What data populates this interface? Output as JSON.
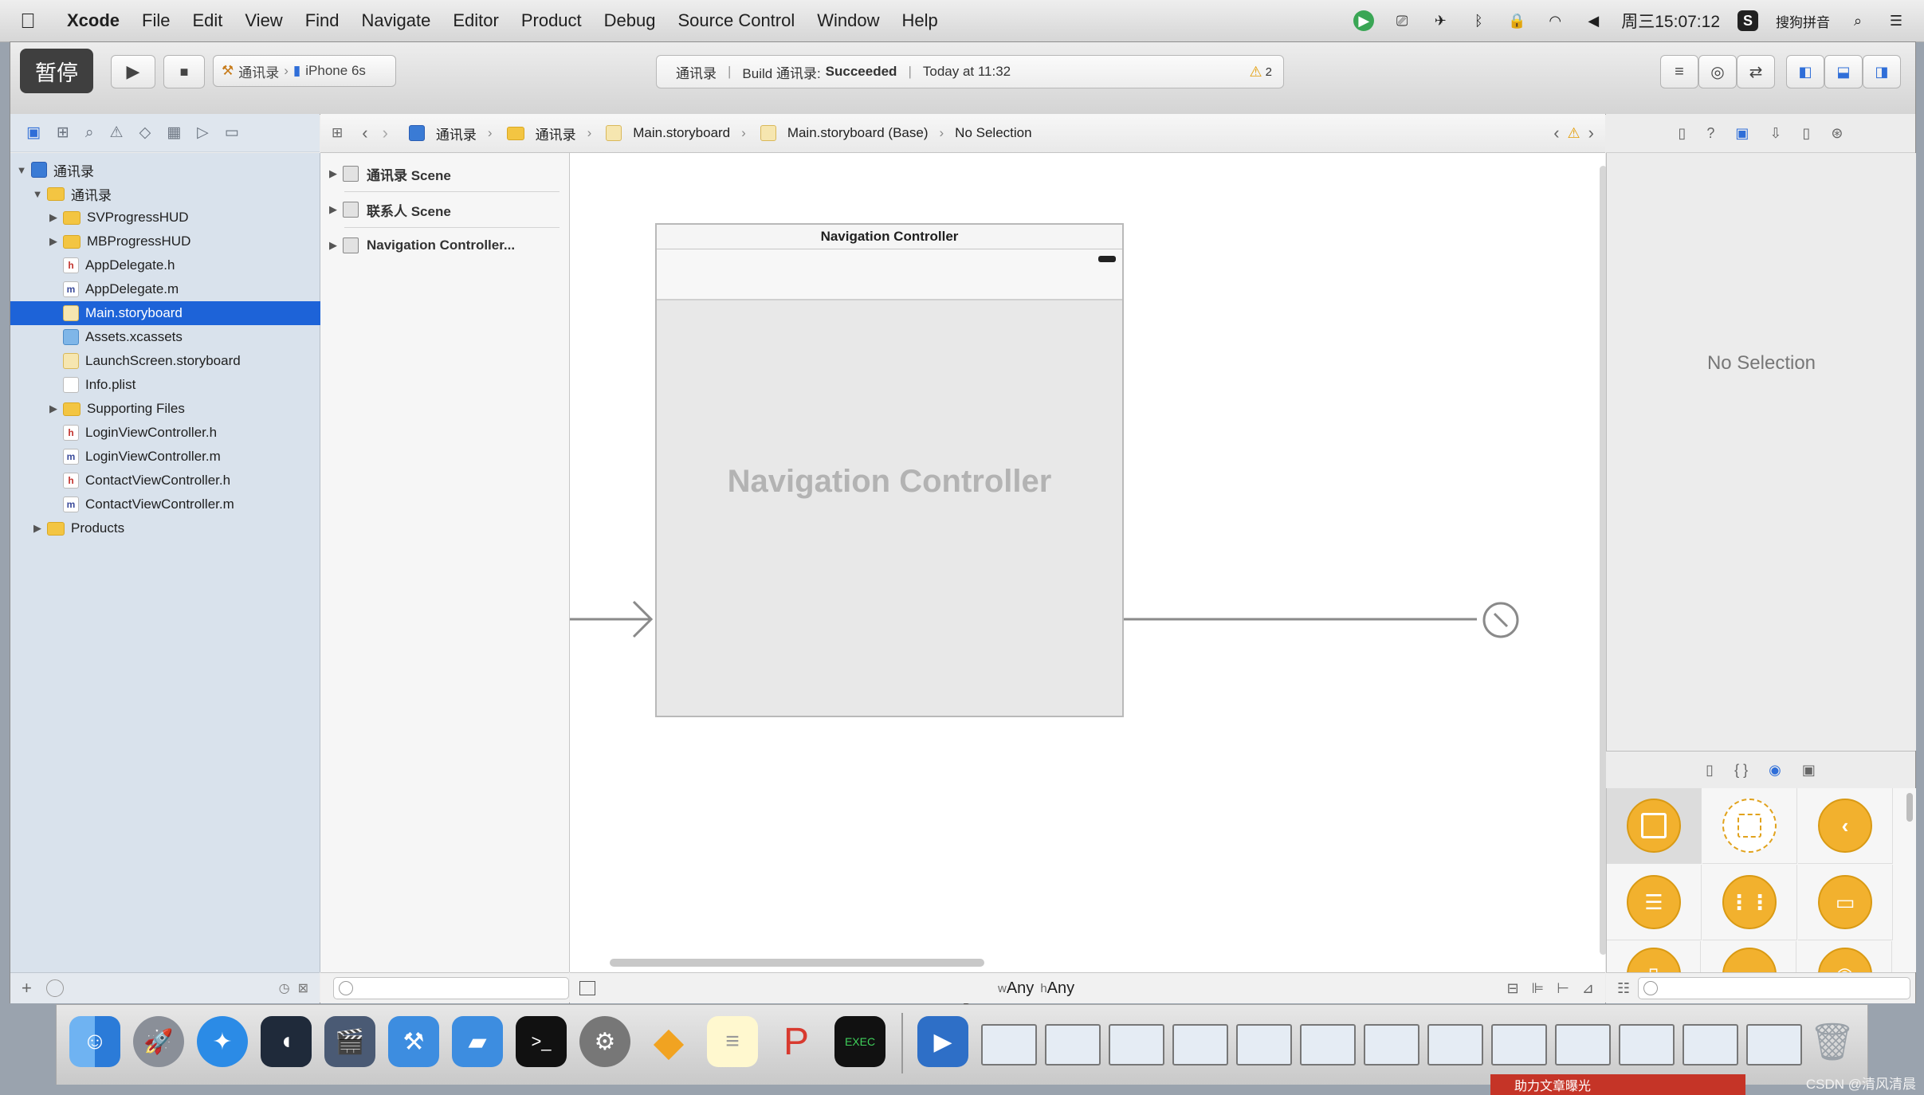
{
  "menubar": {
    "app": "Xcode",
    "items": [
      "File",
      "Edit",
      "View",
      "Find",
      "Navigate",
      "Editor",
      "Product",
      "Debug",
      "Source Control",
      "Window",
      "Help"
    ],
    "clock": "周三15:07:12",
    "input_method": "搜狗拼音"
  },
  "toolbar": {
    "pause_badge": "暂停",
    "scheme": "通讯录",
    "device": "iPhone 6s",
    "status_project": "通讯录",
    "status_build_prefix": "Build 通讯录:",
    "status_build_result": "Succeeded",
    "status_time": "Today at 11:32",
    "warning_count": "2"
  },
  "navigator": {
    "items": [
      {
        "label": "通讯录",
        "icon": "project-icon",
        "depth": 0,
        "disclosure": "open"
      },
      {
        "label": "通讯录",
        "icon": "folder-icon",
        "depth": 1,
        "disclosure": "open"
      },
      {
        "label": "SVProgressHUD",
        "icon": "folder-icon",
        "depth": 2,
        "disclosure": "closed"
      },
      {
        "label": "MBProgressHUD",
        "icon": "folder-icon",
        "depth": 2,
        "disclosure": "closed"
      },
      {
        "label": "AppDelegate.h",
        "icon": "header-file-icon",
        "depth": 2,
        "disclosure": "none"
      },
      {
        "label": "AppDelegate.m",
        "icon": "source-file-icon",
        "depth": 2,
        "disclosure": "none"
      },
      {
        "label": "Main.storyboard",
        "icon": "storyboard-file-icon",
        "depth": 2,
        "disclosure": "none",
        "selected": true
      },
      {
        "label": "Assets.xcassets",
        "icon": "assets-icon",
        "depth": 2,
        "disclosure": "none"
      },
      {
        "label": "LaunchScreen.storyboard",
        "icon": "storyboard-file-icon",
        "depth": 2,
        "disclosure": "none"
      },
      {
        "label": "Info.plist",
        "icon": "plist-file-icon",
        "depth": 2,
        "disclosure": "none"
      },
      {
        "label": "Supporting Files",
        "icon": "folder-icon",
        "depth": 2,
        "disclosure": "closed"
      },
      {
        "label": "LoginViewController.h",
        "icon": "header-file-icon",
        "depth": 2,
        "disclosure": "none"
      },
      {
        "label": "LoginViewController.m",
        "icon": "source-file-icon",
        "depth": 2,
        "disclosure": "none"
      },
      {
        "label": "ContactViewController.h",
        "icon": "header-file-icon",
        "depth": 2,
        "disclosure": "none"
      },
      {
        "label": "ContactViewController.m",
        "icon": "source-file-icon",
        "depth": 2,
        "disclosure": "none"
      },
      {
        "label": "Products",
        "icon": "folder-icon",
        "depth": 1,
        "disclosure": "closed"
      }
    ]
  },
  "jumpbar": {
    "crumbs": [
      "通讯录",
      "通讯录",
      "Main.storyboard",
      "Main.storyboard (Base)",
      "No Selection"
    ]
  },
  "outline": {
    "items": [
      "通讯录 Scene",
      "联系人 Scene",
      "Navigation Controller..."
    ]
  },
  "canvas": {
    "scene_title": "Navigation Controller",
    "scene_label": "Navigation Controller",
    "size_class_w_prefix": "w",
    "size_class_w": "Any",
    "size_class_h_prefix": "h",
    "size_class_h": "Any"
  },
  "inspector": {
    "empty_text": "No Selection"
  },
  "watermark": "CSDN @清风清晨",
  "background_text": "助力文章曝光"
}
